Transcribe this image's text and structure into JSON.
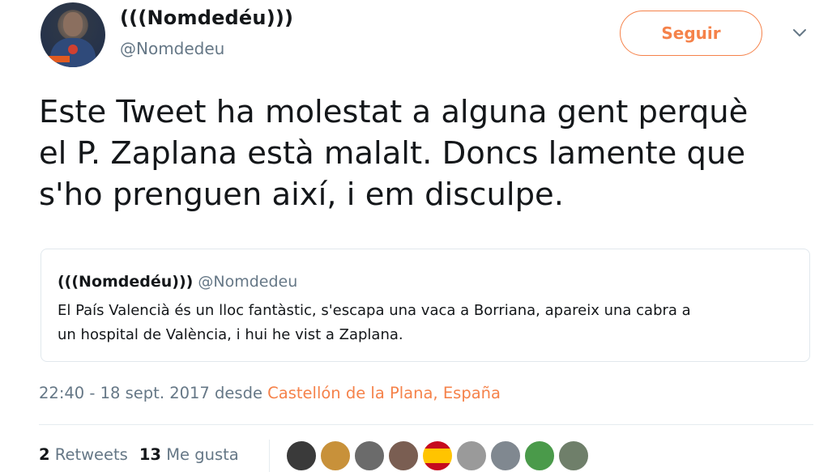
{
  "author": {
    "display_name": "(((Nomdedéu)))",
    "handle": "@Nomdedeu"
  },
  "follow_button_label": "Seguir",
  "tweet": {
    "lines": [
      "Este Tweet ha molestat a alguna gent perquè",
      "el P. Zaplana està malalt. Doncs lamente que",
      "s'ho prenguen així, i em disculpe."
    ]
  },
  "quoted_tweet": {
    "display_name": "(((Nomdedéu)))",
    "handle": "@Nomdedeu",
    "lines": [
      "El País Valencià és un lloc fantàstic, s'escapa una vaca a Borriana, apareix una cabra a",
      "un hospital de València, i hui he vist a Zaplana."
    ]
  },
  "meta": {
    "timestamp": "22:40 - 18 sept. 2017",
    "from_word": "desde",
    "location": "Castellón de la Plana, España"
  },
  "stats": {
    "retweets_count": "2",
    "retweets_label": "Retweets",
    "likes_count": "13",
    "likes_label": "Me gusta"
  },
  "liker_avatars": [
    {
      "name": "liker-1",
      "color": "#3a3a3a"
    },
    {
      "name": "liker-2",
      "color": "#c8913a"
    },
    {
      "name": "liker-3",
      "color": "#6b6b6b"
    },
    {
      "name": "liker-4",
      "color": "#7a5e52"
    },
    {
      "name": "liker-5",
      "color": "#c60b1e"
    },
    {
      "name": "liker-6",
      "color": "#9a9a9a"
    },
    {
      "name": "liker-7",
      "color": "#808890"
    },
    {
      "name": "liker-8",
      "color": "#4a9a4a"
    },
    {
      "name": "liker-9",
      "color": "#6f7f6a"
    }
  ],
  "colors": {
    "accent": "#f5824a",
    "secondary_text": "#657786",
    "primary_text": "#14171a"
  }
}
